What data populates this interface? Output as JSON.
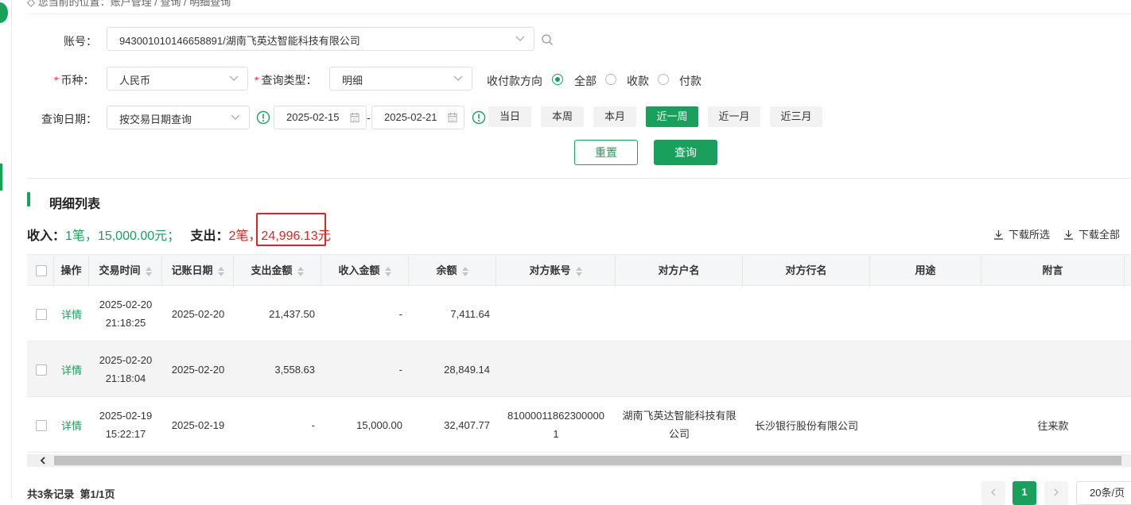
{
  "breadcrumb": "◇ 您当前的位置：账户管理 / 查询 / 明细查询",
  "filters": {
    "account_label": "账号：",
    "account_value": "943001010146658891/湖南飞英达智能科技有限公司",
    "currency_label": "币种：",
    "currency_value": "人民币",
    "query_type_label": "查询类型：",
    "query_type_value": "明细",
    "direction_label": "收付款方向",
    "direction_options": [
      "全部",
      "收款",
      "付款"
    ],
    "direction_selected": "全部",
    "date_label": "查询日期：",
    "date_mode_value": "按交易日期查询",
    "date_start": "2025-02-15",
    "date_end": "2025-02-21",
    "date_dash": "-",
    "quick_ranges": [
      "当日",
      "本周",
      "本月",
      "近一周",
      "近一月",
      "近三月"
    ],
    "quick_active": "近一周",
    "required_mark": "*"
  },
  "actions": {
    "reset_label": "重置",
    "query_label": "查询"
  },
  "section": {
    "title": "明细列表"
  },
  "summary": {
    "income_label": "收入：",
    "income_count": "1",
    "income_unit": "笔，",
    "income_amount": "15,000.00",
    "income_currency": "元；",
    "expense_label": "支出：",
    "expense_count": "2",
    "expense_unit": "笔，",
    "expense_amount": "24,996.13",
    "expense_currency": "元"
  },
  "downloads": {
    "selected_label": "下载所选",
    "all_label": "下载全部"
  },
  "table": {
    "headers": {
      "op": "操作",
      "trade_time": "交易时间",
      "post_date": "记账日期",
      "debit": "支出金额",
      "credit": "收入金额",
      "balance": "余额",
      "cp_account": "对方账号",
      "cp_name": "对方户名",
      "cp_bank": "对方行名",
      "purpose": "用途",
      "remark": "附言"
    },
    "rows": [
      {
        "op": "详情",
        "trade_date": "2025-02-20",
        "trade_clock": "21:18:25",
        "post_date": "2025-02-20",
        "debit": "21,437.50",
        "credit": "-",
        "balance": "7,411.64",
        "cp_account_1": "",
        "cp_account_2": "",
        "cp_name_1": "",
        "cp_name_2": "",
        "cp_bank": "",
        "purpose": "",
        "remark": ""
      },
      {
        "op": "详情",
        "trade_date": "2025-02-20",
        "trade_clock": "21:18:04",
        "post_date": "2025-02-20",
        "debit": "3,558.63",
        "credit": "-",
        "balance": "28,849.14",
        "cp_account_1": "",
        "cp_account_2": "",
        "cp_name_1": "",
        "cp_name_2": "",
        "cp_bank": "",
        "purpose": "",
        "remark": ""
      },
      {
        "op": "详情",
        "trade_date": "2025-02-19",
        "trade_clock": "15:22:17",
        "post_date": "2025-02-19",
        "debit": "-",
        "credit": "15,000.00",
        "balance": "32,407.77",
        "cp_account_1": "81000011862300000",
        "cp_account_2": "1",
        "cp_name_1": "湖南飞英达智能科技有限",
        "cp_name_2": "公司",
        "cp_bank": "长沙银行股份有限公司",
        "purpose": "",
        "remark": "往来款"
      }
    ]
  },
  "footer": {
    "total_text": "共3条记录",
    "page_text": "第1/1页",
    "current_page": "1",
    "page_size": "20条/页"
  },
  "colors": {
    "accent": "#19a05c",
    "expense": "#e02424",
    "highlight_box": "#e02424"
  }
}
